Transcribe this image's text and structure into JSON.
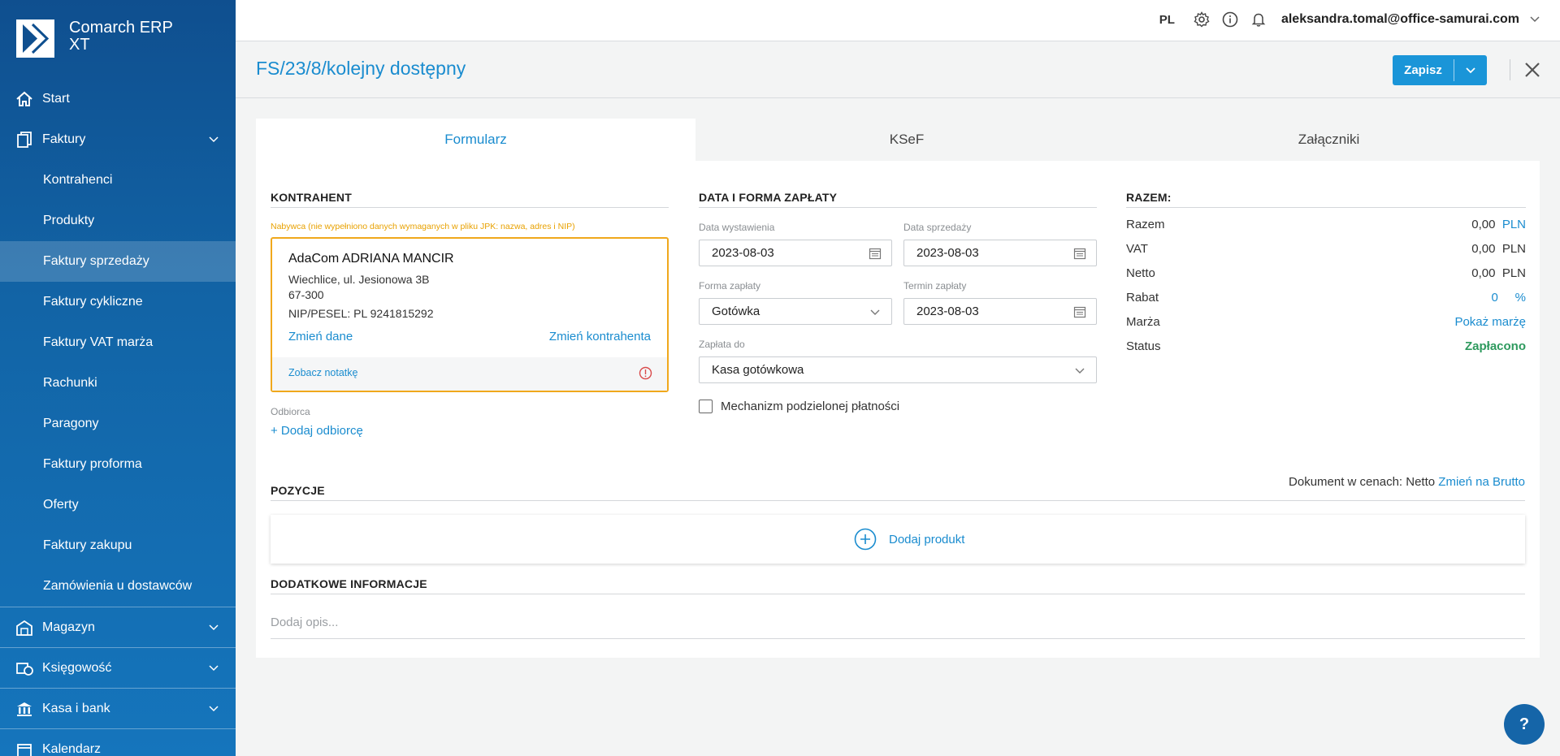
{
  "app": {
    "name": "Comarch ERP XT"
  },
  "sidebar": {
    "items": [
      {
        "label": "Start",
        "icon": "home-icon"
      },
      {
        "label": "Faktury",
        "icon": "documents-icon",
        "expandable": true
      },
      {
        "label": "Kontrahenci"
      },
      {
        "label": "Produkty"
      },
      {
        "label": "Faktury sprzedaży",
        "active": true
      },
      {
        "label": "Faktury cykliczne"
      },
      {
        "label": "Faktury VAT marża"
      },
      {
        "label": "Rachunki"
      },
      {
        "label": "Paragony"
      },
      {
        "label": "Faktury proforma"
      },
      {
        "label": "Oferty"
      },
      {
        "label": "Faktury zakupu"
      },
      {
        "label": "Zamówienia u dostawców"
      },
      {
        "label": "Magazyn",
        "icon": "warehouse-icon",
        "expandable": true
      },
      {
        "label": "Księgowość",
        "icon": "accounting-icon",
        "expandable": true
      },
      {
        "label": "Kasa i bank",
        "icon": "bank-icon",
        "expandable": true
      },
      {
        "label": "Kalendarz",
        "icon": "calendar-icon"
      }
    ]
  },
  "topbar": {
    "lang": "PL",
    "user_email": "aleksandra.tomal@office-samurai.com"
  },
  "header": {
    "title": "FS/23/8/kolejny dostępny",
    "save_label": "Zapisz"
  },
  "tabs": [
    {
      "label": "Formularz",
      "active": true
    },
    {
      "label": "KSeF"
    },
    {
      "label": "Załączniki"
    }
  ],
  "kontrahent": {
    "title": "KONTRAHENT",
    "warning": "Nabywca (nie wypełniono danych wymaganych w pliku JPK: nazwa, adres i NIP)",
    "name": "AdaCom ADRIANA MANCIR",
    "address1": "Wiechlice, ul. Jesionowa 3B",
    "address2": "67-300",
    "nip": "NIP/PESEL: PL 9241815292",
    "change_data": "Zmień dane",
    "change_contractor": "Zmień kontrahenta",
    "note_link": "Zobacz notatkę",
    "odbiorca_label": "Odbiorca",
    "add_odbiorca": "+ Dodaj odbiorcę"
  },
  "payment": {
    "title": "DATA I FORMA ZAPŁATY",
    "issue_date_label": "Data wystawienia",
    "issue_date": "2023-08-03",
    "sale_date_label": "Data sprzedaży",
    "sale_date": "2023-08-03",
    "payment_form_label": "Forma zapłaty",
    "payment_form": "Gotówka",
    "due_date_label": "Termin zapłaty",
    "due_date": "2023-08-03",
    "paid_to_label": "Zapłata do",
    "paid_to": "Kasa gotówkowa",
    "split_payment_label": "Mechanizm podzielonej płatności"
  },
  "razem": {
    "title": "RAZEM:",
    "rows": [
      {
        "label": "Razem",
        "value": "0,00",
        "unit": "PLN"
      },
      {
        "label": "VAT",
        "value": "0,00",
        "unit": "PLN"
      },
      {
        "label": "Netto",
        "value": "0,00",
        "unit": "PLN"
      },
      {
        "label": "Rabat",
        "value": "0",
        "unit": "%"
      },
      {
        "label": "Marża",
        "value": "Pokaż marżę"
      },
      {
        "label": "Status",
        "value": "Zapłacono"
      }
    ]
  },
  "pozycje": {
    "title": "POZYCJE",
    "price_mode_text": "Dokument w cenach: Netto",
    "price_mode_link": "Zmień na Brutto",
    "add_product": "Dodaj produkt"
  },
  "dodatkowe": {
    "title": "DODATKOWE INFORMACJE",
    "placeholder": "Dodaj opis..."
  },
  "colors": {
    "accent": "#1a8ccf",
    "warning": "#f0a81c",
    "success": "#2e9a5e",
    "sidebar": "#1264a6"
  }
}
